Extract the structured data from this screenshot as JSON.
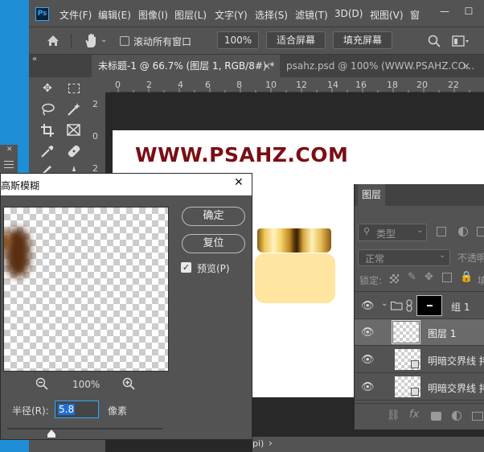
{
  "menu": {
    "logo": "Ps",
    "items": [
      "文件(F)",
      "编辑(E)",
      "图像(I)",
      "图层(L)",
      "文字(Y)",
      "选择(S)",
      "滤镜(T)",
      "3D(D)",
      "视图(V)",
      "窗"
    ],
    "controls": [
      "—",
      "☐"
    ]
  },
  "options": {
    "scroll_all": "滚动所有窗口",
    "zoom": "100%",
    "fit_screen": "适合屏幕",
    "fill_screen": "填充屏幕"
  },
  "tabs": [
    {
      "label": "未标题-1 @ 66.7% (图层 1, RGB/8#) *",
      "close": "×"
    },
    {
      "label": "psahz.psd @ 100% (WWW.PSAHZ.CO...",
      "close": "×"
    }
  ],
  "ruler": {
    "h": [
      "0",
      "2",
      "4",
      "6",
      "8",
      "10",
      "12",
      "14",
      "16",
      "18",
      "20",
      "22"
    ],
    "v": [
      "2",
      "0",
      "2"
    ]
  },
  "document": {
    "watermark": "WWW.PSAHZ.COM"
  },
  "layers_panel": {
    "title": "图层",
    "filter": "类型",
    "blend_mode": "正常",
    "opacity_label": "不透明",
    "lock_label": "锁定:",
    "fill_label": "填",
    "layers": [
      {
        "name": "组 1",
        "type": "group"
      },
      {
        "name": "图层 1",
        "type": "layer",
        "selected": true
      },
      {
        "name": "明暗交界线 拷",
        "type": "layer"
      },
      {
        "name": "明暗交界线 拷",
        "type": "layer"
      }
    ],
    "footer_icons": [
      "link-icon",
      "fx-icon",
      "mask-icon",
      "adjustment-icon",
      "group-icon"
    ]
  },
  "dialog": {
    "title": "高斯模糊",
    "close": "✕",
    "ok": "确定",
    "reset": "复位",
    "preview_label": "预览(P)",
    "preview_checked": true,
    "zoom": "100%",
    "radius_label": "半径(R):",
    "radius_value": "5.8",
    "radius_unit": "像素"
  },
  "status": {
    "text": "pi)",
    "arrow": "›"
  },
  "colors": {
    "ui_bg": "#535353",
    "dark_bg": "#282828",
    "accent": "#31a8ff",
    "desktop": "#1e8fd6",
    "watermark": "#7a0e16",
    "cap_gold": "#f0c85a",
    "jar_body": "#ffe5a0"
  }
}
